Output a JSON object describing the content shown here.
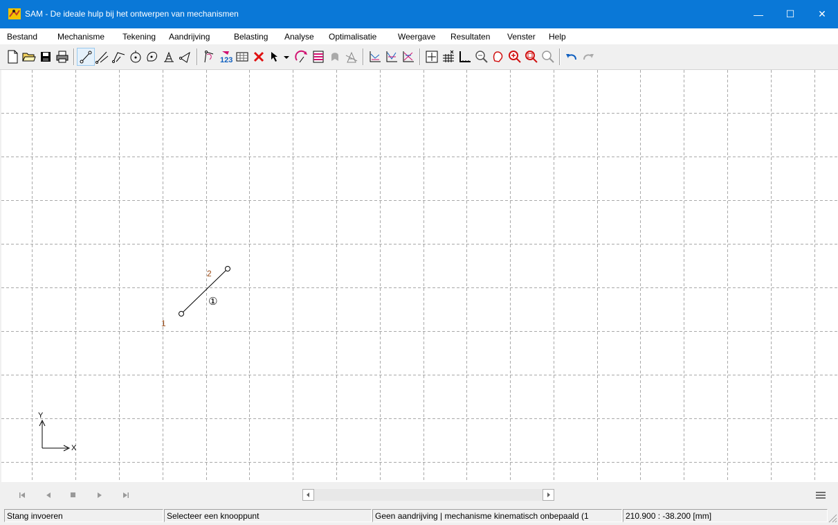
{
  "window": {
    "title": "SAM - De ideale hulp bij het ontwerpen van mechanismen",
    "controls": [
      "—",
      "☐",
      "✕"
    ]
  },
  "menu": [
    "Bestand",
    "Mechanisme",
    "Tekening",
    "Aandrijving",
    "Belasting",
    "Analyse",
    "Optimalisatie",
    "Weergave",
    "Resultaten",
    "Venster",
    "Help"
  ],
  "toolbar": {
    "icons": [
      "new-document",
      "open-folder",
      "save",
      "print",
      "draw-link",
      "draw-slider",
      "draw-angled-link",
      "draw-gear",
      "draw-cam",
      "draw-spring",
      "draw-damper",
      "trace-path",
      "numbering",
      "table",
      "delete",
      "pointer-select",
      "select-dropdown",
      "drive",
      "beam-frame",
      "ghost-element",
      "machine",
      "graph-xy",
      "graph-multi",
      "graph-compare",
      "grid-add",
      "grid-toggle",
      "ruler",
      "zoom-out",
      "pan",
      "zoom-in",
      "zoom-window",
      "zoom-all",
      "undo",
      "redo"
    ]
  },
  "drawing": {
    "node_labels": [
      "1",
      "2"
    ],
    "element_label": "①",
    "axis_labels": {
      "x": "X",
      "y": "Y"
    },
    "colors": {
      "node_label": "#9a4a14",
      "line": "#000000",
      "grid": "#a8a8a8"
    }
  },
  "navigation": {
    "icons": [
      "first-frame",
      "previous-frame",
      "stop",
      "next-frame",
      "last-frame",
      "menu-lines"
    ]
  },
  "status": {
    "mode": "Stang invoeren",
    "hint": "Selecteer een knooppunt",
    "drive_state": "Geen aandrijving | mechanisme kinematisch onbepaald (1",
    "coordinates": "210.900 : -38.200 [mm]"
  }
}
